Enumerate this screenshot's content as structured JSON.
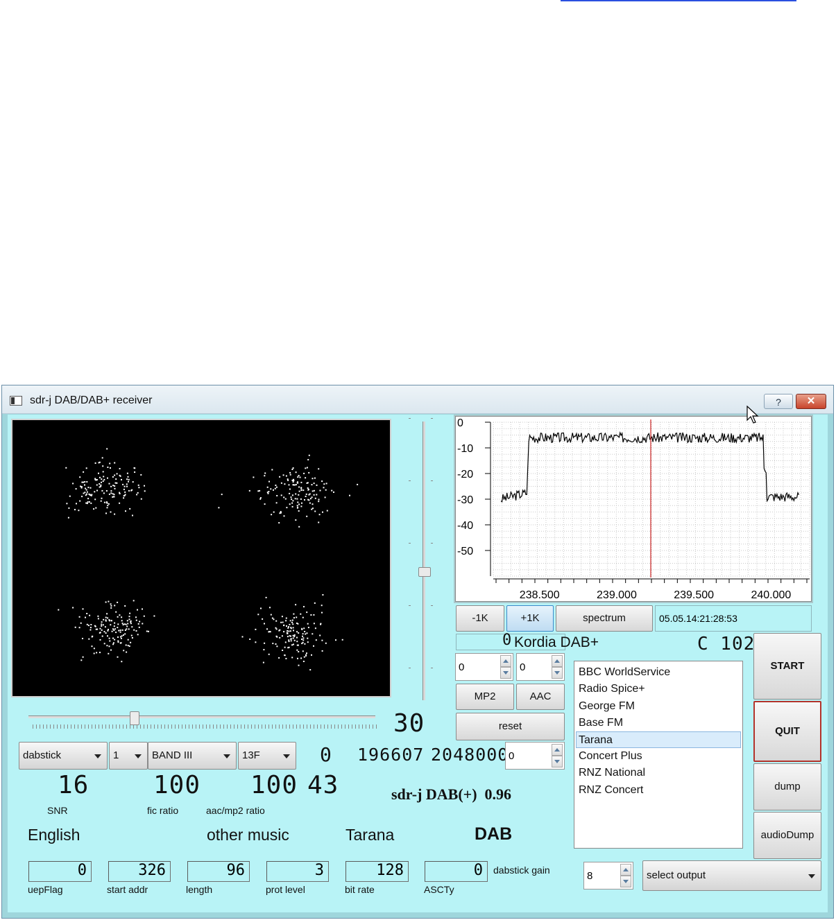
{
  "window": {
    "title": "sdr-j DAB/DAB+ receiver",
    "help_label": "?",
    "close_label": "✕"
  },
  "spectrum": {
    "y_ticks": [
      "0",
      "-10",
      "-20",
      "-30",
      "-40",
      "-50"
    ],
    "x_ticks": [
      "238.500",
      "239.000",
      "239.500",
      "240.000"
    ],
    "marker_color": "#cc2222"
  },
  "controls": {
    "minus1k": "-1K",
    "plus1k": "+1K",
    "spectrum": "spectrum",
    "timestamp": "05.05.14:21:28:53",
    "ensemble_name": "Kordia DAB+",
    "ensemble_lcd": "0",
    "channel_lcd": "C 102",
    "spin_a": "0",
    "spin_b": "0",
    "mp2": "MP2",
    "aac": "AAC",
    "reset": "reset",
    "start": "START",
    "quit": "QUIT",
    "dump": "dump",
    "audiodump": "audioDump"
  },
  "services": [
    "BBC WorldService",
    "Radio Spice+",
    "George FM",
    "Base FM",
    "Tarana",
    "Concert Plus",
    "RNZ National",
    "RNZ Concert"
  ],
  "selected_service": "Tarana",
  "tuning": {
    "slider_value": "30",
    "device": "dabstick",
    "device_index": "1",
    "band": "BAND III",
    "channel": "13F",
    "lcd_a": "0",
    "lcd_b": "196607",
    "lcd_c": "2048000",
    "spin_c": "0"
  },
  "stats": {
    "snr_value": "16",
    "snr_label": "SNR",
    "fic_value": "100",
    "fic_label": "fic ratio",
    "aac_value": "100",
    "aac_label": "aac/mp2 ratio",
    "extra_value": "43",
    "version": "sdr-j DAB(+)  0.96"
  },
  "info": {
    "language": "English",
    "genre": "other music",
    "station": "Tarana",
    "mode": "DAB"
  },
  "boxes": [
    {
      "value": "0",
      "label": "uepFlag"
    },
    {
      "value": "326",
      "label": "start addr"
    },
    {
      "value": "96",
      "label": "length"
    },
    {
      "value": "3",
      "label": "prot level"
    },
    {
      "value": "128",
      "label": "bit rate"
    },
    {
      "value": "0",
      "label": "ASCTy"
    }
  ],
  "gain": {
    "label": "dabstick gain",
    "value": "8"
  },
  "output": {
    "label": "select output"
  }
}
